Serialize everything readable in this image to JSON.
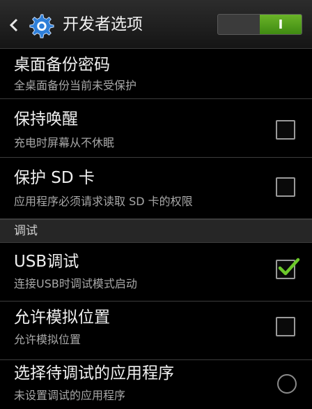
{
  "header": {
    "title": "开发者选项",
    "toggle_label": "I",
    "accent_color": "#4a9a1a"
  },
  "items": [
    {
      "title": "桌面备份密码",
      "summary": "全桌面备份当前未受保护",
      "has_checkbox": false
    },
    {
      "title": "保持唤醒",
      "summary": "充电时屏幕从不休眠",
      "checked": false
    },
    {
      "title": "保护 SD 卡",
      "summary": "应用程序必须请求读取 SD 卡的权限",
      "checked": false
    },
    {
      "title": "USB调试",
      "summary": "连接USB时调试模式启动",
      "checked": true
    },
    {
      "title": "允许模拟位置",
      "summary": "允许模拟位置",
      "checked": false
    },
    {
      "title": "选择待调试的应用程序",
      "summary": "未设置调试的应用程序"
    }
  ],
  "section": {
    "debug_header": "调试"
  },
  "icons": {
    "back": "chevron-left-icon",
    "settings": "gear-icon",
    "check": "checkmark-icon"
  }
}
